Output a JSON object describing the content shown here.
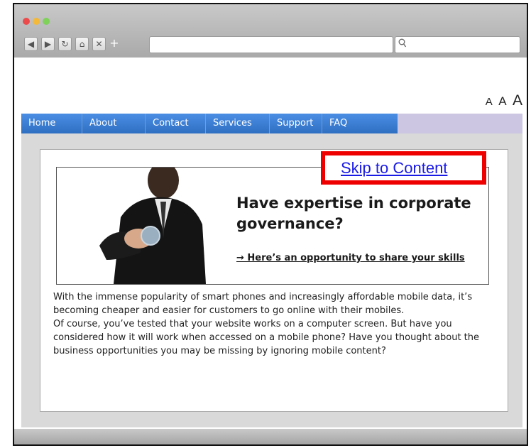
{
  "browser": {
    "traffic_lights": [
      "#ec4b4b",
      "#f3b93a",
      "#7fd15a"
    ],
    "nav_buttons": [
      {
        "name": "back-button",
        "glyph": "◀"
      },
      {
        "name": "forward-button",
        "glyph": "▶"
      },
      {
        "name": "reload-button",
        "glyph": "↻"
      },
      {
        "name": "home-button",
        "glyph": "⌂"
      },
      {
        "name": "stop-button",
        "glyph": "✕"
      }
    ],
    "new_tab_glyph": "+",
    "url_value": "",
    "search_icon_glyph": "🔍"
  },
  "text_size": {
    "small": "A",
    "medium": "A",
    "large": "A"
  },
  "menu": {
    "items": [
      "Home",
      "About",
      "Contact",
      "Services",
      "Support",
      "FAQ"
    ],
    "colors": {
      "bar": "#2f6fc2",
      "bar_end": "#cdc6e2"
    }
  },
  "banner": {
    "headline_line1": "Have expertise in corporate",
    "headline_line2": "governance?",
    "cta": "→ Here’s an opportunity to share your skills"
  },
  "body": {
    "para1": "With the immense popularity of smart phones and increasingly affordable mobile data, it’s becoming cheaper and easier for customers to go online with their mobiles.",
    "para2": "Of course, you’ve tested that your website works on a computer screen. But have you considered how it will work when accessed on a mobile phone? Have you thought about the business opportunities you may be missing by ignoring mobile content?"
  },
  "skip_link": {
    "label": "Skip to Content",
    "highlight_color": "#ee0000"
  }
}
